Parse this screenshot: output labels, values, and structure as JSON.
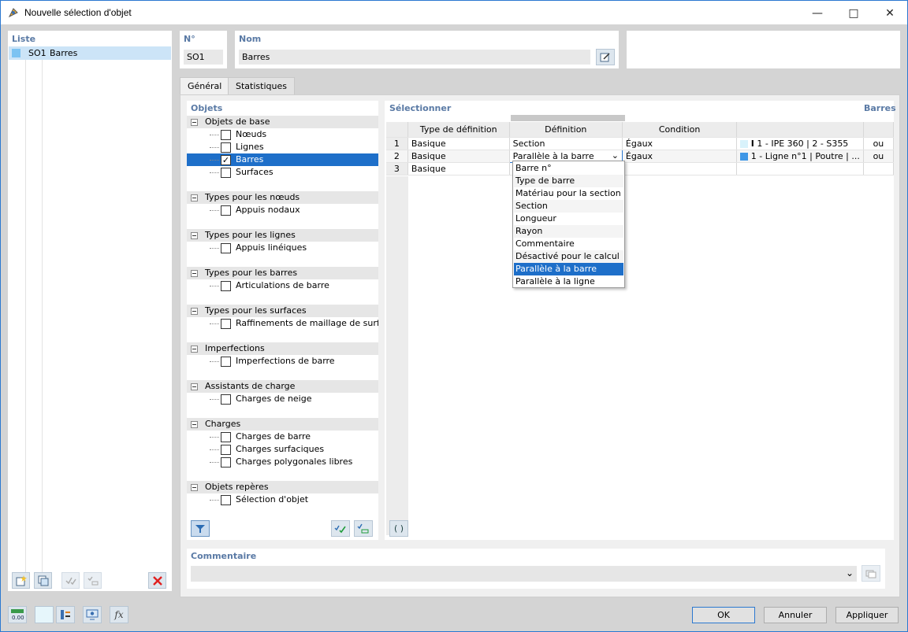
{
  "window": {
    "title": "Nouvelle sélection d'objet"
  },
  "list": {
    "header": "Liste",
    "items": [
      {
        "id": "SO1",
        "name": "Barres",
        "color": "#7cc3f2"
      }
    ]
  },
  "number": {
    "label": "N°",
    "value": "SO1"
  },
  "name": {
    "label": "Nom",
    "value": "Barres"
  },
  "tabs": [
    {
      "label": "Général",
      "active": true
    },
    {
      "label": "Statistiques",
      "active": false
    }
  ],
  "objets": {
    "header": "Objets",
    "groups": [
      {
        "label": "Objets de base",
        "items": [
          {
            "label": "Nœuds",
            "checked": false
          },
          {
            "label": "Lignes",
            "checked": false
          },
          {
            "label": "Barres",
            "checked": true,
            "selected": true
          },
          {
            "label": "Surfaces",
            "checked": false
          }
        ]
      },
      {
        "label": "Types pour les nœuds",
        "items": [
          {
            "label": "Appuis nodaux",
            "checked": false
          }
        ]
      },
      {
        "label": "Types pour les lignes",
        "items": [
          {
            "label": "Appuis linéiques",
            "checked": false
          }
        ]
      },
      {
        "label": "Types pour les barres",
        "items": [
          {
            "label": "Articulations de barre",
            "checked": false
          }
        ]
      },
      {
        "label": "Types pour les surfaces",
        "items": [
          {
            "label": "Raffinements de maillage de surfac",
            "checked": false
          }
        ]
      },
      {
        "label": "Imperfections",
        "items": [
          {
            "label": "Imperfections de barre",
            "checked": false
          }
        ]
      },
      {
        "label": "Assistants de charge",
        "items": [
          {
            "label": "Charges de neige",
            "checked": false
          }
        ]
      },
      {
        "label": "Charges",
        "items": [
          {
            "label": "Charges de barre",
            "checked": false
          },
          {
            "label": "Charges surfaciques",
            "checked": false
          },
          {
            "label": "Charges polygonales libres",
            "checked": false
          }
        ]
      },
      {
        "label": "Objets repères",
        "items": [
          {
            "label": "Sélection d'objet",
            "checked": false
          }
        ]
      }
    ]
  },
  "selection": {
    "header": "Sélectionner",
    "type_label": "Barres",
    "columns": [
      "Type de définition",
      "Définition",
      "Condition",
      "",
      ""
    ],
    "rows": [
      {
        "n": "1",
        "type": "Basique",
        "definition": "Section",
        "condition": "Égaux",
        "value": "1 - IPE 360 | 2 - S355",
        "logic": "ou"
      },
      {
        "n": "2",
        "type": "Basique",
        "definition": "Parallèle à la barre",
        "condition": "Égaux",
        "value": "1 - Ligne n°1 | Poutre | ...",
        "logic": "ou"
      },
      {
        "n": "3",
        "type": "Basique",
        "definition": "",
        "condition": "",
        "value": "",
        "logic": ""
      }
    ],
    "dropdown_options": [
      "Barre n°",
      "Type de barre",
      "Matériau pour la section",
      "Section",
      "Longueur",
      "Rayon",
      "Commentaire",
      "Désactivé pour le calcul",
      "Parallèle à la barre",
      "Parallèle à la ligne"
    ],
    "dropdown_selected": "Parallèle à la barre",
    "bracket_button": "( )"
  },
  "comment": {
    "label": "Commentaire",
    "value": ""
  },
  "buttons": {
    "ok": "OK",
    "cancel": "Annuler",
    "apply": "Appliquer"
  },
  "colors": {
    "accent": "#1e6fc9",
    "header_text": "#5a7aa5",
    "delete_red": "#e02020"
  }
}
